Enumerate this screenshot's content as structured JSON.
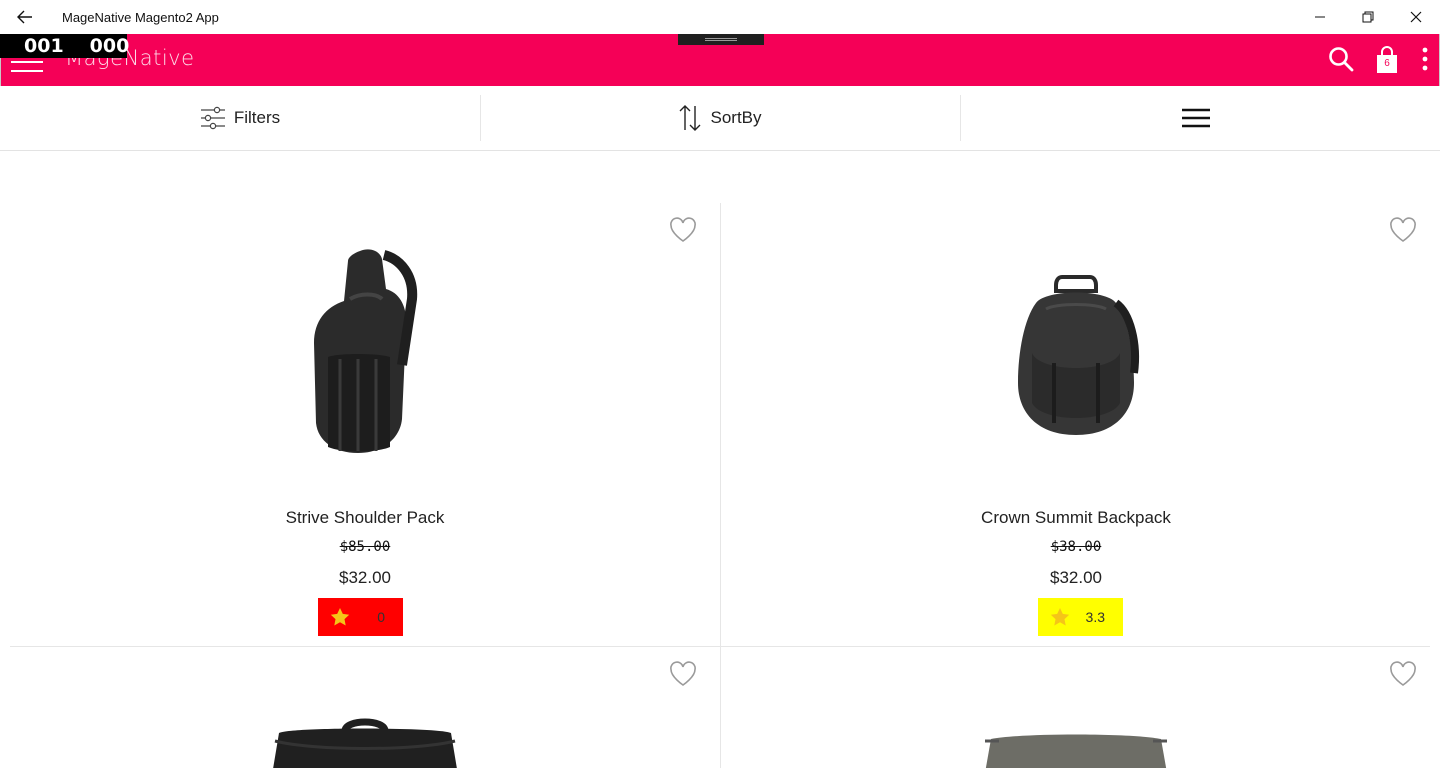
{
  "window": {
    "title": "MageNative Magento2 App"
  },
  "counter": {
    "left": "001",
    "right": "000"
  },
  "appbar": {
    "logo_text": "MageNative",
    "cart_count": "6",
    "brand_color": "#f50057"
  },
  "toolbar": {
    "filters_label": "Filters",
    "sortby_label": "SortBy"
  },
  "products": [
    {
      "name": "Strive Shoulder Pack",
      "old_price": "$85.00",
      "price": "$32.00",
      "rating": "0",
      "rating_color": "#ff0000"
    },
    {
      "name": "Crown Summit Backpack",
      "old_price": "$38.00",
      "price": "$32.00",
      "rating": "3.3",
      "rating_color": "#ffff00"
    },
    {
      "name": "",
      "old_price": "",
      "price": "",
      "rating": ""
    },
    {
      "name": "",
      "old_price": "",
      "price": "",
      "rating": ""
    }
  ]
}
